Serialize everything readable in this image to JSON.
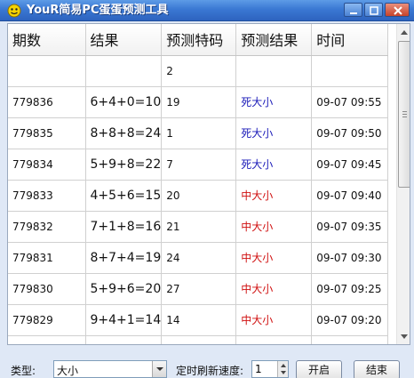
{
  "window": {
    "title": "YouR简易PC蛋蛋预测工具",
    "minimize_label": "",
    "maximize_label": "",
    "close_label": ""
  },
  "table": {
    "headers": [
      "期数",
      "结果",
      "预测特码",
      "预测结果",
      "时间"
    ],
    "rows": [
      {
        "period": "",
        "result": "",
        "prediction": "2",
        "pred_result": "",
        "time": "",
        "color": ""
      },
      {
        "period": "779836",
        "result": "6+4+0=10",
        "prediction": "19",
        "pred_result": "死大小",
        "time": "09-07 09:55",
        "color": "blue"
      },
      {
        "period": "779835",
        "result": "8+8+8=24",
        "prediction": "1",
        "pred_result": "死大小",
        "time": "09-07 09:50",
        "color": "blue"
      },
      {
        "period": "779834",
        "result": "5+9+8=22",
        "prediction": "7",
        "pred_result": "死大小",
        "time": "09-07 09:45",
        "color": "blue"
      },
      {
        "period": "779833",
        "result": "4+5+6=15",
        "prediction": "20",
        "pred_result": "中大小",
        "time": "09-07 09:40",
        "color": "red"
      },
      {
        "period": "779832",
        "result": "7+1+8=16",
        "prediction": "21",
        "pred_result": "中大小",
        "time": "09-07 09:35",
        "color": "red"
      },
      {
        "period": "779831",
        "result": "8+7+4=19",
        "prediction": "24",
        "pred_result": "中大小",
        "time": "09-07 09:30",
        "color": "red"
      },
      {
        "period": "779830",
        "result": "5+9+6=20",
        "prediction": "27",
        "pred_result": "中大小",
        "time": "09-07 09:25",
        "color": "red"
      },
      {
        "period": "779829",
        "result": "9+4+1=14",
        "prediction": "14",
        "pred_result": "中大小",
        "time": "09-07 09:20",
        "color": "red"
      },
      {
        "period": "",
        "result": "",
        "prediction": "",
        "pred_result": "",
        "time": "",
        "color": ""
      }
    ]
  },
  "controls": {
    "type_label": "类型:",
    "type_value": "大小",
    "refresh_label": "定时刷新速度:",
    "refresh_value": "1",
    "start_label": "开启",
    "stop_label": "结束"
  },
  "colors": {
    "titlebar": "#3a78d3",
    "lose_text": "#1a1ab8",
    "win_text": "#d01010"
  },
  "icons": {
    "app": "smiley-icon",
    "type_dropdown": "chevron-down-icon",
    "spin": "spin-arrows-icon",
    "scroll_up": "scroll-up-icon",
    "scroll_down": "scroll-down-icon"
  }
}
